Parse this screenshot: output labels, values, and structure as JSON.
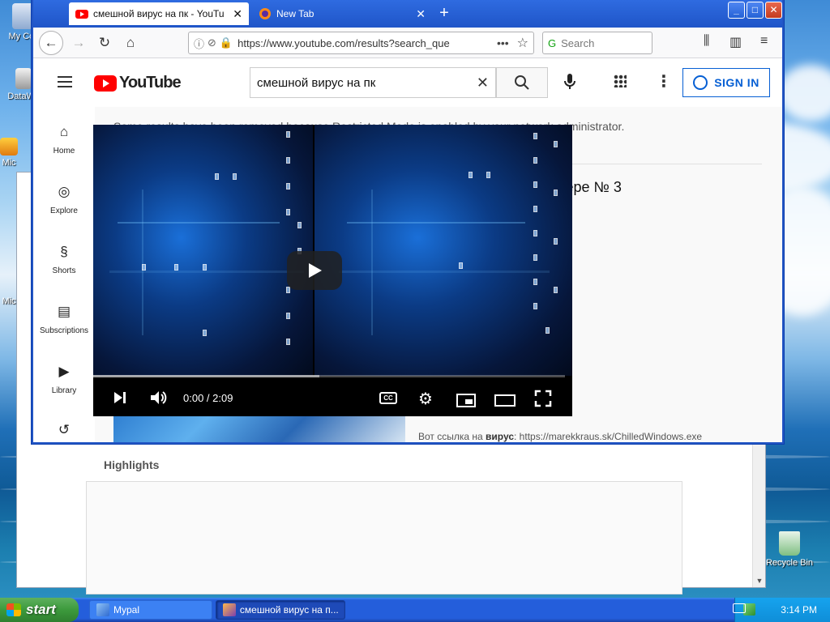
{
  "desktop": {
    "icons": [
      {
        "label": "My Com",
        "name": "my-computer"
      },
      {
        "label": "DataWa",
        "name": "datawa"
      },
      {
        "label": "Mic",
        "name": "mic-1"
      },
      {
        "label": "Mic",
        "name": "mic-2"
      },
      {
        "label": "Recycle Bin",
        "name": "recycle-bin"
      }
    ]
  },
  "browser": {
    "tabs": [
      {
        "title": "смешной вирус на пк - YouTube",
        "favicon": "youtube-icon",
        "active": true
      },
      {
        "title": "New Tab",
        "favicon": "firefox-icon",
        "active": false
      }
    ],
    "url": "https://www.youtube.com/results?search_que",
    "search_placeholder": "Search",
    "window_buttons": [
      "_",
      "□",
      "✕"
    ]
  },
  "youtube": {
    "logo_text": "YouTube",
    "search_query": "смешной вирус на пк",
    "signin_label": "SIGN IN",
    "guide": [
      {
        "label": "Home",
        "icon": "home-icon",
        "glyph": "⌂"
      },
      {
        "label": "Explore",
        "icon": "explore-icon",
        "glyph": "◎"
      },
      {
        "label": "Shorts",
        "icon": "shorts-icon",
        "glyph": "§"
      },
      {
        "label": "Subscriptions",
        "icon": "subscriptions-icon",
        "glyph": "▤"
      },
      {
        "label": "Library",
        "icon": "library-icon",
        "glyph": "▶"
      },
      {
        "label": "",
        "icon": "history-icon",
        "glyph": "↺"
      }
    ],
    "restricted_notice": "Some results have been removed because Restricted Mode is enabled by your network administrator.",
    "result_title_partial": "ьютере № 3",
    "result_desc_prefix": "Вот ссылка на ",
    "result_desc_bold": "вирус",
    "result_desc_suffix": ": https://marekkraus.sk/ChilledWindows.exe"
  },
  "player": {
    "time": "0:00 / 2:09",
    "progress_loaded": 0.48
  },
  "background_page": {
    "highlights_label": "Highlights"
  },
  "taskbar": {
    "start_label": "start",
    "tasks": [
      {
        "label": "Mypal",
        "active": false
      },
      {
        "label": "смешной вирус на п...",
        "active": true
      }
    ],
    "clock": "3:14 PM"
  }
}
